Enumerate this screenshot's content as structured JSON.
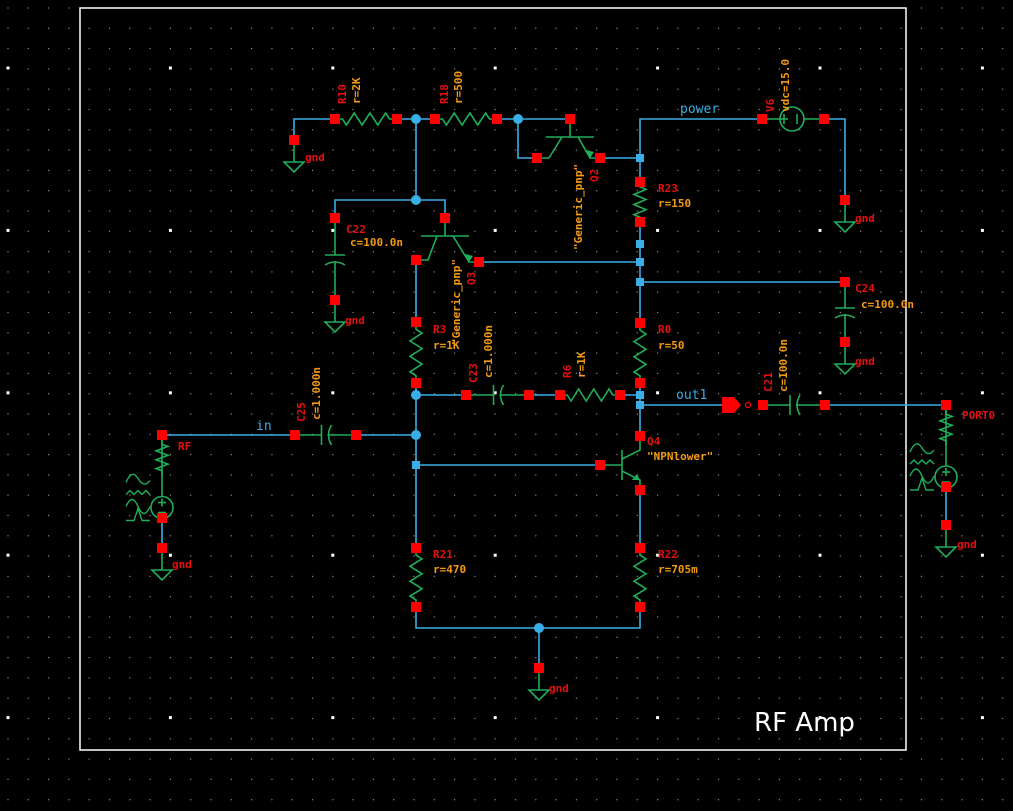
{
  "sheet": {
    "title": "RF Amp"
  },
  "colors": {
    "background": "#000000",
    "wire": "#3aaee6",
    "component": "#1fae5a",
    "pin": "#ff0000",
    "instance_name": "#e41010",
    "parameter": "#f39a12",
    "border": "#ffffff"
  },
  "nets": {
    "in": "in",
    "out1": "out1",
    "power": "power"
  },
  "components": {
    "R10": {
      "name": "R10",
      "param": "r=2K"
    },
    "R18": {
      "name": "R18",
      "param": "r=500"
    },
    "Q2": {
      "name": "Q2",
      "param": "\"Generic_pnp\""
    },
    "Q3": {
      "name": "Q3",
      "param": "\"Generic_pnp\""
    },
    "C22": {
      "name": "C22",
      "param": "c=100.0n"
    },
    "V6": {
      "name": "V6",
      "param": "vdc=15.0"
    },
    "R23": {
      "name": "R23",
      "param": "r=150"
    },
    "C24": {
      "name": "C24",
      "param": "c=100.0n"
    },
    "R0": {
      "name": "R0",
      "param": "r=50"
    },
    "R3": {
      "name": "R3",
      "param": "r=1K"
    },
    "C23": {
      "name": "C23",
      "param": "c=1.000n"
    },
    "R6": {
      "name": "R6",
      "param": "r=1K"
    },
    "C21": {
      "name": "C21",
      "param": "c=100.0n"
    },
    "C25": {
      "name": "C25",
      "param": "c=1.000n"
    },
    "Q4": {
      "name": "Q4",
      "param": "\"NPNlower\""
    },
    "R21": {
      "name": "R21",
      "param": "r=470"
    },
    "R22": {
      "name": "R22",
      "param": "r=705m"
    },
    "RF": {
      "name": "RF"
    },
    "PORT0": {
      "name": "PORT0"
    }
  },
  "gnd_label": "gnd"
}
